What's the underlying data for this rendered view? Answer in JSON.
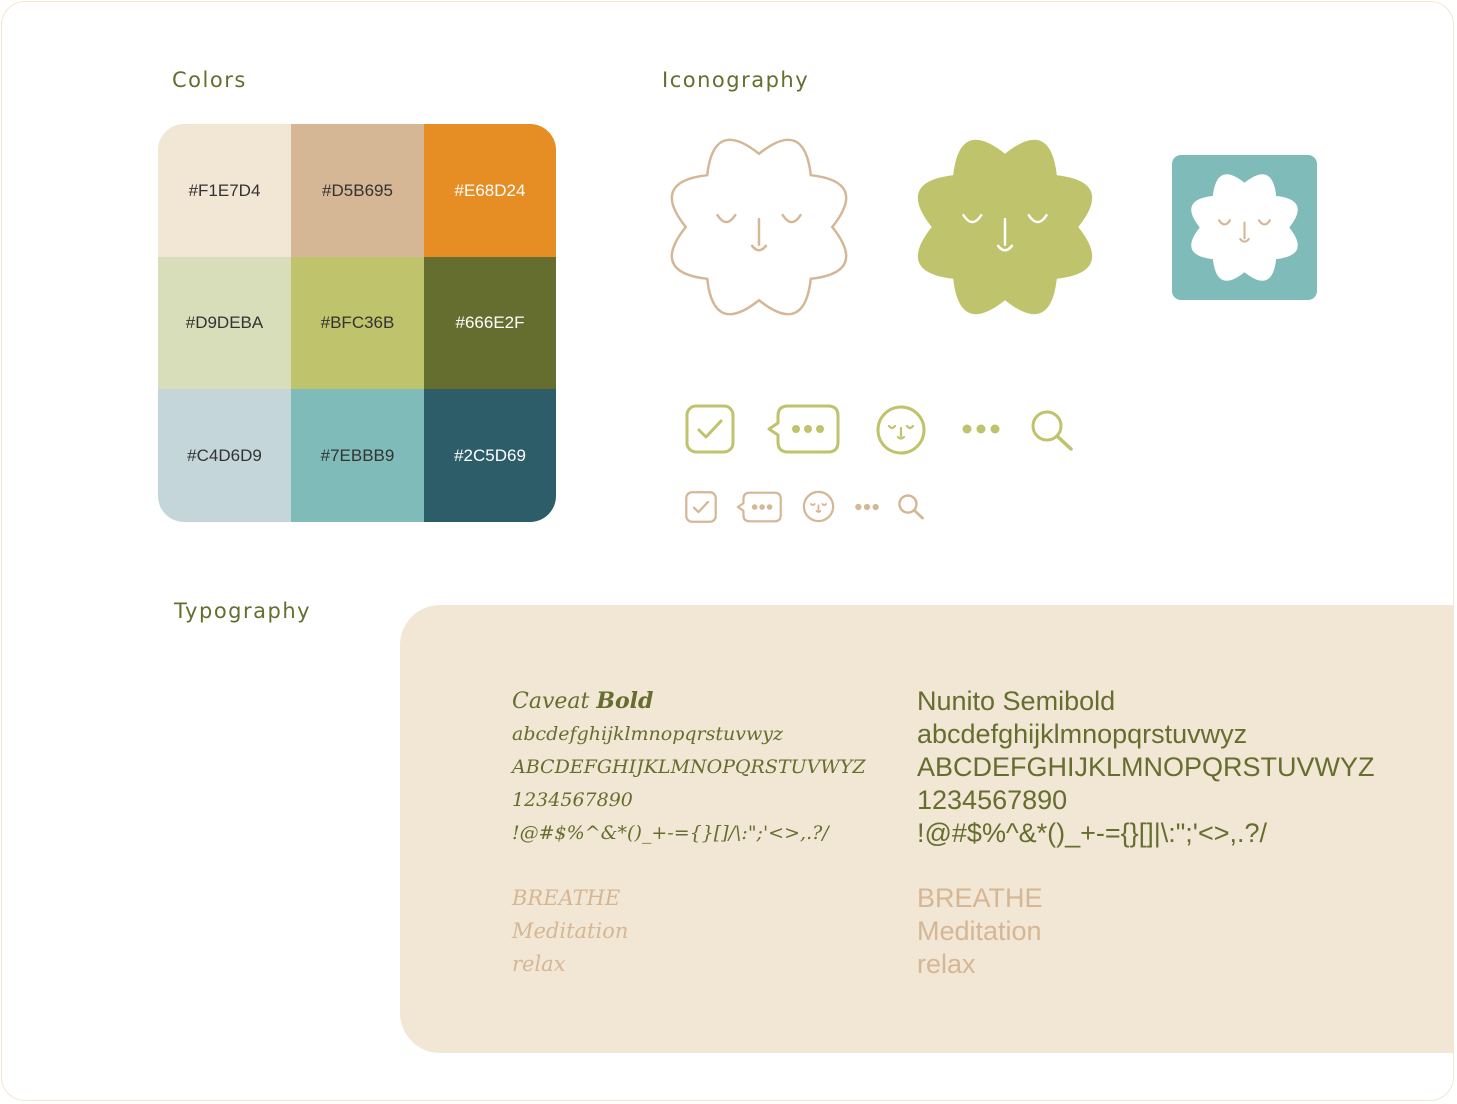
{
  "sections": {
    "colors": "Colors",
    "iconography": "Iconography",
    "typography": "Typography"
  },
  "palette": [
    {
      "hex": "#F1E7D4",
      "label": "#F1E7D4",
      "text": "#333333"
    },
    {
      "hex": "#D5B695",
      "label": "#D5B695",
      "text": "#333333"
    },
    {
      "hex": "#E68D24",
      "label": "#E68D24",
      "text": "#ffffff"
    },
    {
      "hex": "#D9DEBA",
      "label": "#D9DEBA",
      "text": "#333333"
    },
    {
      "hex": "#BFC36B",
      "label": "#BFC36B",
      "text": "#333333"
    },
    {
      "hex": "#666E2F",
      "label": "#666E2F",
      "text": "#ffffff"
    },
    {
      "hex": "#C4D6D9",
      "label": "#C4D6D9",
      "text": "#333333"
    },
    {
      "hex": "#7EBBB9",
      "label": "#7EBBB9",
      "text": "#333333"
    },
    {
      "hex": "#2C5D69",
      "label": "#2C5D69",
      "text": "#ffffff"
    }
  ],
  "icons": {
    "large": [
      "cloud-face-outline-icon",
      "cloud-face-filled-icon",
      "app-icon"
    ],
    "row_green": [
      "checkbox-icon",
      "chat-bubble-icon",
      "smiley-face-icon",
      "more-dots-icon",
      "search-icon"
    ],
    "row_tan": [
      "checkbox-icon",
      "chat-bubble-icon",
      "smiley-face-icon",
      "more-dots-icon",
      "search-icon"
    ],
    "colors": {
      "green": "#BFC36B",
      "tan": "#D5B695",
      "teal": "#7EBBB9"
    }
  },
  "typography": {
    "caveat": {
      "name_regular": "Caveat ",
      "name_bold": "Bold",
      "lower": "abcdefghijklmnopqrstuvwyz",
      "upper": "ABCDEFGHIJKLMNOPQRSTUVWYZ",
      "digits": "1234567890",
      "symbols": "!@#$%^&*()_+-={}[]/\\:\";'<>,.?/",
      "samples": [
        "BREATHE",
        "Meditation",
        "relax"
      ]
    },
    "nunito": {
      "name": "Nunito Semibold",
      "lower": "abcdefghijklmnopqrstuvwyz",
      "upper": "ABCDEFGHIJKLMNOPQRSTUVWYZ",
      "digits": "1234567890",
      "symbols": "!@#$%^&*()_+-={}[]|\\:\";'<>,.?/",
      "samples": [
        "BREATHE",
        "Meditation",
        "relax"
      ]
    },
    "colors": {
      "primary": "#666E2F",
      "secondary": "#D5B695",
      "panel": "#F1E7D4"
    }
  }
}
